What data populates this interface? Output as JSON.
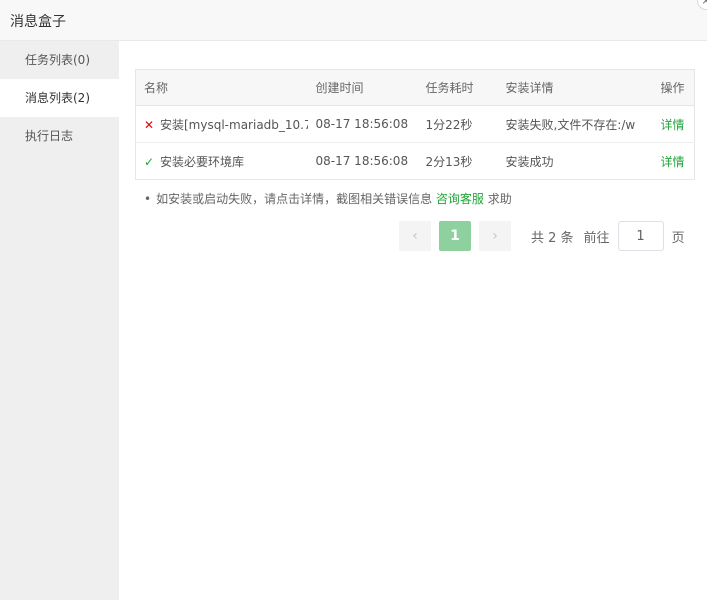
{
  "window": {
    "title": "消息盒子",
    "close_glyph": "×"
  },
  "sidebar": {
    "items": [
      {
        "label": "任务列表(0)"
      },
      {
        "label": "消息列表(2)"
      },
      {
        "label": "执行日志"
      }
    ],
    "active": "消息列表(2)"
  },
  "table": {
    "headers": [
      "名称",
      "创建时间",
      "任务耗时",
      "安装详情",
      "操作"
    ],
    "rows": [
      {
        "status": "fail",
        "status_icon": "✕",
        "name": "安装[mysql-mariadb_10.7",
        "created": "08-17 18:56:08",
        "duration": "1分22秒",
        "detail": "安装失败,文件不存在:/w",
        "action": "详情"
      },
      {
        "status": "success",
        "status_icon": "✓",
        "name": "安装必要环境库",
        "created": "08-17 18:56:08",
        "duration": "2分13秒",
        "detail": "安装成功",
        "action": "详情"
      }
    ]
  },
  "note": {
    "bullet": "•",
    "text_before": "如安装或启动失败，请点击详情，截图相关错误信息 ",
    "link": "咨询客服",
    "text_after": " 求助"
  },
  "pagination": {
    "prev_glyph": "‹",
    "next_glyph": "›",
    "current_page": "1",
    "total": "共 2 条",
    "goto_label": "前往",
    "goto_value": "1",
    "unit": "页"
  },
  "colors": {
    "accent_green": "#20a53a",
    "error_red": "#e00000",
    "sidebar_bg": "#efefef"
  }
}
